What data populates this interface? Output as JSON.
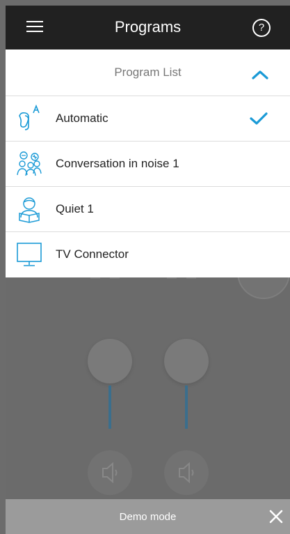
{
  "topbar": {
    "title": "Programs",
    "help_glyph": "?"
  },
  "panel": {
    "header_label": "Program List",
    "items": [
      {
        "label": "Automatic",
        "icon": "automatic-ear-icon",
        "selected": true
      },
      {
        "label": "Conversation in noise 1",
        "icon": "group-conversation-icon",
        "selected": false
      },
      {
        "label": "Quiet 1",
        "icon": "reading-person-icon",
        "selected": false
      },
      {
        "label": "TV Connector",
        "icon": "tv-icon",
        "selected": false
      }
    ]
  },
  "demobar": {
    "label": "Demo mode"
  },
  "colors": {
    "accent": "#1a9ad6",
    "topbar": "#212121",
    "overlay": "#6b6b6b",
    "demobar": "#9b9b9b"
  }
}
